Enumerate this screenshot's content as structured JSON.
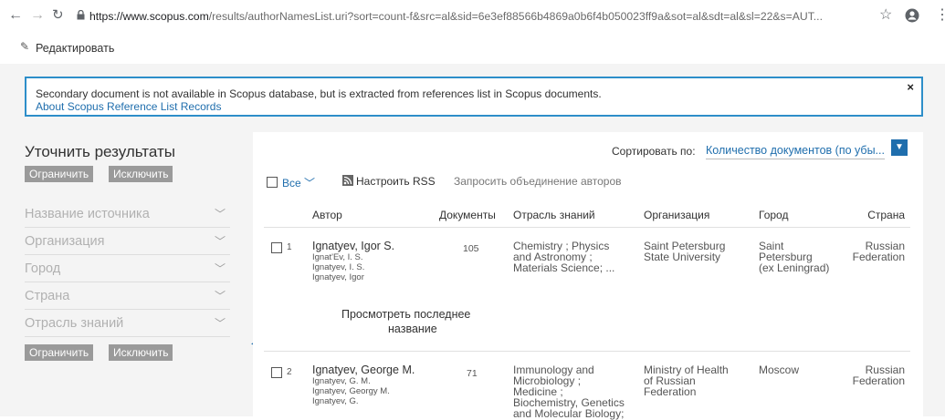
{
  "browser": {
    "url_host": "https://www.scopus.com",
    "url_rest": "/results/authorNamesList.uri?sort=count-f&src=al&sid=6e3ef88566b4869a0b6f4b050023ff9a&sot=al&sdt=al&sl=22&s=AUT..."
  },
  "edit": {
    "label": "Редактировать"
  },
  "notice": {
    "text": "Secondary document is not available in Scopus database, but is extracted from references list in Scopus documents.",
    "link": "About Scopus Reference List Records",
    "close": "×"
  },
  "refine": {
    "title": "Уточнить результаты",
    "limit": "Ограничить",
    "exclude": "Исключить",
    "facets": [
      "Название источника",
      "Организация",
      "Город",
      "Страна",
      "Отрасль знаний"
    ]
  },
  "sort": {
    "label": "Сортировать по:",
    "value": "Количество документов (по убы..."
  },
  "toolbar": {
    "all": "Все",
    "rss": "Настроить RSS",
    "merge": "Запросить объединение авторов"
  },
  "columns": [
    "Автор",
    "Документы",
    "Отрасль знаний",
    "Организация",
    "Город",
    "Страна"
  ],
  "rows": [
    {
      "num": "1",
      "name": "Ignatyev, Igor S.",
      "aliases": [
        "Ignat'Ev, I. S.",
        "Ignatyev, I. S.",
        "Ignatyev, Igor"
      ],
      "docs": "105",
      "field": [
        "Chemistry ; Physics",
        "and Astronomy ;",
        "Materials Science; ..."
      ],
      "org": [
        "Saint Petersburg",
        "State University"
      ],
      "city": [
        "Saint",
        "Petersburg",
        "(ex Leningrad)"
      ],
      "country": [
        "Russian",
        "Federation"
      ],
      "last_title": [
        "Просмотреть последнее",
        "название"
      ]
    },
    {
      "num": "2",
      "name": "Ignatyev, George M.",
      "aliases": [
        "Ignatyev, G. M.",
        "Ignatyev, Georgy M.",
        "Ignatyev, G."
      ],
      "docs": "71",
      "field": [
        "Immunology and",
        "Microbiology ;",
        "Medicine ;",
        "Biochemistry, Genetics",
        "and Molecular Biology;"
      ],
      "org": [
        "Ministry of Health",
        "of Russian",
        "Federation"
      ],
      "city": [
        "Moscow"
      ],
      "country": [
        "Russian",
        "Federation"
      ]
    }
  ]
}
